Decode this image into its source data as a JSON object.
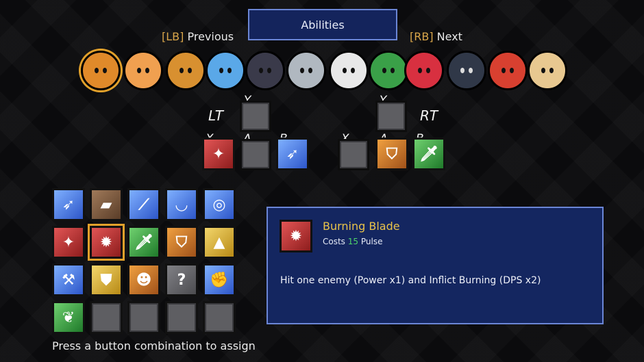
{
  "header": {
    "title": "Abilities",
    "prev_key": "[LB]",
    "prev_label": "Previous",
    "next_key": "[RB]",
    "next_label": "Next"
  },
  "portraits": [
    {
      "name": "character-1",
      "color": "#e08a2a",
      "selected": true
    },
    {
      "name": "character-2",
      "color": "#f0a050",
      "selected": false
    },
    {
      "name": "character-3",
      "color": "#d89030",
      "selected": false
    },
    {
      "name": "character-4",
      "color": "#5aa8e8",
      "selected": false
    },
    {
      "name": "character-5",
      "color": "#3a3a4a",
      "selected": false
    },
    {
      "name": "character-6",
      "color": "#b0b8c0",
      "selected": false
    },
    {
      "name": "character-7",
      "color": "#e8e8e8",
      "selected": false
    },
    {
      "name": "character-8",
      "color": "#3aa048",
      "selected": false
    },
    {
      "name": "character-9",
      "color": "#d83040",
      "selected": false
    },
    {
      "name": "character-10",
      "color": "#303848",
      "selected": false
    },
    {
      "name": "character-11",
      "color": "#d84030",
      "selected": false
    },
    {
      "name": "character-12",
      "color": "#e8c890",
      "selected": false
    }
  ],
  "loadout": {
    "left": {
      "trigger": "LT",
      "y": "Y",
      "x": "X",
      "a": "A",
      "b": "B"
    },
    "right": {
      "trigger": "RT",
      "y": "Y",
      "x": "X",
      "a": "A",
      "b": "B"
    }
  },
  "panel": {
    "name": "Burning Blade",
    "cost_prefix": "Costs",
    "cost_value": "15",
    "cost_suffix": "Pulse",
    "description": "Hit one enemy (Power x1) and Inflict Burning (DPS x2)"
  },
  "hint": "Press a button combination to assign",
  "grid_glyphs": {
    "unknown": "?"
  }
}
